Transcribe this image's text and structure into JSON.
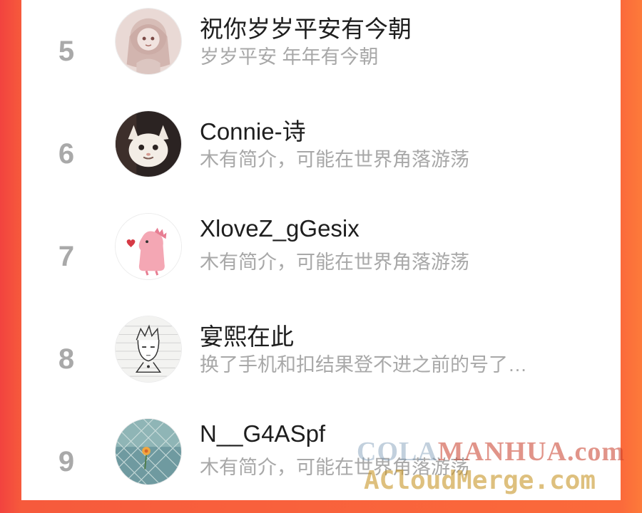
{
  "rows": [
    {
      "rank": "5",
      "name": "祝你岁岁平安有今朝",
      "bio": "岁岁平安 年年有今朝"
    },
    {
      "rank": "6",
      "name": "Connie-诗",
      "bio": "木有简介，可能在世界角落游荡"
    },
    {
      "rank": "7",
      "name": "XloveZ_gGesix",
      "bio": "木有简介，可能在世界角落游荡"
    },
    {
      "rank": "8",
      "name": "宴熙在此",
      "bio": "换了手机和扣结果登不进之前的号了…"
    },
    {
      "rank": "9",
      "name": "N__G4ASpf",
      "bio": "木有简介，可能在世界角落游荡"
    }
  ],
  "watermark": {
    "line1_a": "COLA",
    "line1_b": "MANHUA.com",
    "line2": "ACloudMerge.com"
  },
  "colors": {
    "accent_left": "#f2433f",
    "accent_right": "#fd7a3a",
    "rank_gray": "#a9a9a9",
    "name": "#1e1e1e",
    "bio": "#a8a8a8"
  },
  "icons": [
    "avatar-anime-girl",
    "avatar-cat",
    "avatar-pink-dinosaur",
    "avatar-sketch-boy",
    "avatar-fence-flower"
  ]
}
